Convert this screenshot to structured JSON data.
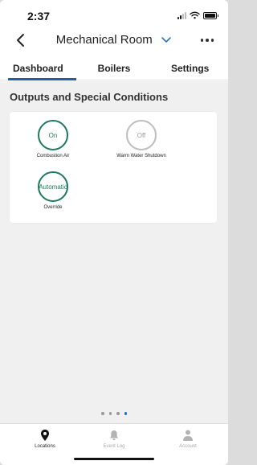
{
  "status_bar": {
    "time": "2:37"
  },
  "header": {
    "title": "Mechanical Room"
  },
  "tabs": [
    {
      "label": "Dashboard",
      "active": true
    },
    {
      "label": "Boilers",
      "active": false
    },
    {
      "label": "Settings",
      "active": false
    }
  ],
  "section": {
    "title": "Outputs and Special Conditions",
    "items": [
      {
        "state": "On",
        "label": "Combustion Air",
        "status": "on"
      },
      {
        "state": "Off",
        "label": "Warm Water Shutdown",
        "status": "off"
      },
      {
        "state": "Automatic",
        "label": "Override",
        "status": "on"
      }
    ]
  },
  "pager": {
    "total": 4,
    "active_index": 4
  },
  "bottom_nav": [
    {
      "label": "Locations",
      "icon": "location-pin-icon",
      "active": true
    },
    {
      "label": "Event Log",
      "icon": "bell-icon",
      "active": false
    },
    {
      "label": "Account",
      "icon": "person-icon",
      "active": false
    }
  ],
  "colors": {
    "accent": "#1e5fa6",
    "on_green": "#1e7a5a",
    "off_gray": "#bdbdbd",
    "pager_active": "#1e6fd0"
  }
}
